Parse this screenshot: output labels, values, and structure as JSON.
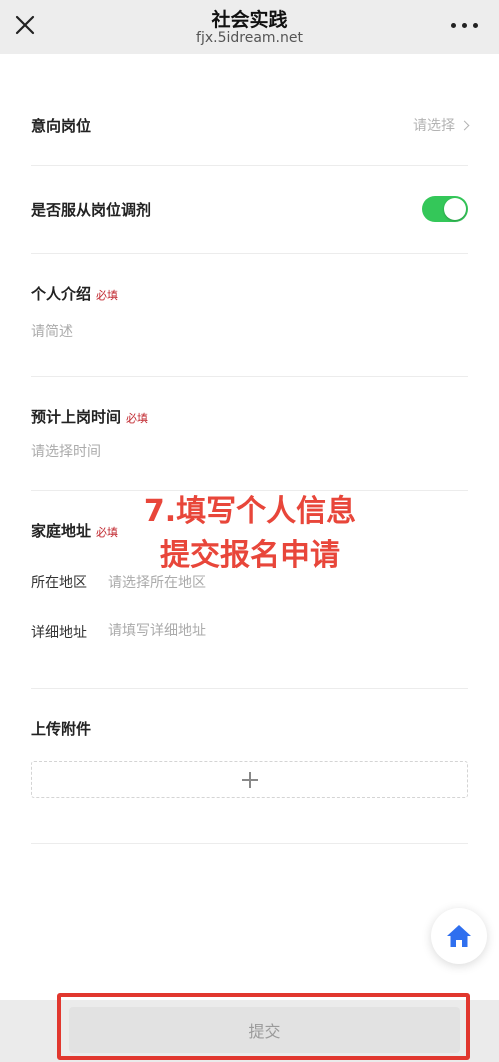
{
  "nav": {
    "title": "社会实践",
    "domain": "fjx.5idream.net"
  },
  "form": {
    "position": {
      "label": "意向岗位",
      "select_text": "请选择"
    },
    "obey_adjust": {
      "label": "是否服从岗位调剂",
      "enabled": true,
      "toggle_color": "#34c759"
    },
    "intro": {
      "label": "个人介绍",
      "required": "必填",
      "placeholder": "请简述"
    },
    "start_time": {
      "label": "预计上岗时间",
      "required": "必填",
      "placeholder": "请选择时间"
    },
    "address": {
      "label": "家庭地址",
      "required": "必填",
      "region_label": "所在地区",
      "region_placeholder": "请选择所在地区",
      "detail_label": "详细地址",
      "detail_placeholder": "请填写详细地址"
    },
    "attachment": {
      "label": "上传附件",
      "add_icon": "plus-icon"
    }
  },
  "annotation": {
    "line1": "7.填写个人信息",
    "line2": "提交报名申请",
    "color": "#e8463a"
  },
  "home_button": {
    "icon": "home-icon",
    "color": "#2f6fef"
  },
  "footer": {
    "submit_label": "提交",
    "highlight_color": "#e1372e"
  }
}
